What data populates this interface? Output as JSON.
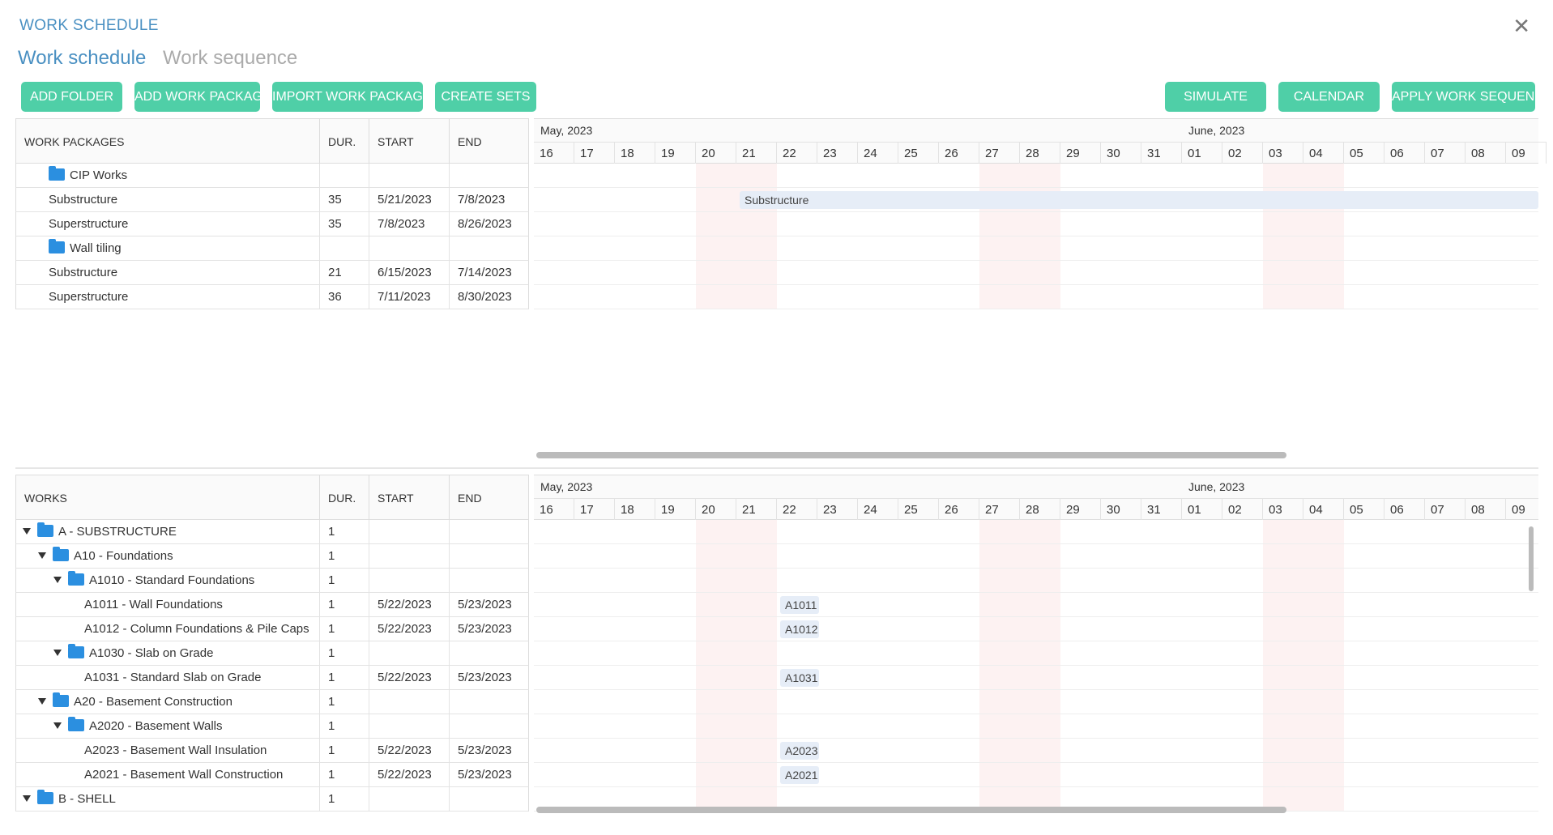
{
  "window": {
    "title": "WORK SCHEDULE",
    "close_glyph": "✕"
  },
  "tabs": [
    {
      "label": "Work schedule",
      "active": true
    },
    {
      "label": "Work sequence",
      "active": false
    }
  ],
  "toolbar": {
    "add_folder": "ADD FOLDER",
    "add_work_package": "ADD WORK PACKAGE",
    "import_work_packages": "IMPORT WORK PACKAGES",
    "create_sets": "CREATE SETS",
    "simulate": "SIMULATE",
    "calendar": "CALENDAR",
    "apply_work_sequence": "APPLY WORK SEQUENCE"
  },
  "timeline": {
    "month1": "May, 2023",
    "month2": "June, 2023",
    "days": [
      "16",
      "17",
      "18",
      "19",
      "20",
      "21",
      "22",
      "23",
      "24",
      "25",
      "26",
      "27",
      "28",
      "29",
      "30",
      "31",
      "01",
      "02",
      "03",
      "04",
      "05",
      "06",
      "07",
      "08",
      "09"
    ]
  },
  "packages": {
    "headers": {
      "name": "WORK PACKAGES",
      "dur": "DUR.",
      "start": "START",
      "end": "END"
    },
    "rows": [
      {
        "name": "CIP Works",
        "folder": true,
        "dur": "",
        "start": "",
        "end": ""
      },
      {
        "name": "Substructure",
        "folder": false,
        "dur": "35",
        "start": "5/21/2023",
        "end": "7/8/2023",
        "bar": "Substructure"
      },
      {
        "name": "Superstructure",
        "folder": false,
        "dur": "35",
        "start": "7/8/2023",
        "end": "8/26/2023"
      },
      {
        "name": "Wall tiling",
        "folder": true,
        "dur": "",
        "start": "",
        "end": ""
      },
      {
        "name": "Substructure",
        "folder": false,
        "dur": "21",
        "start": "6/15/2023",
        "end": "7/14/2023"
      },
      {
        "name": "Superstructure",
        "folder": false,
        "dur": "36",
        "start": "7/11/2023",
        "end": "8/30/2023"
      }
    ]
  },
  "works": {
    "headers": {
      "name": "WORKS",
      "dur": "DUR.",
      "start": "START",
      "end": "END"
    },
    "rows": [
      {
        "name": "A - SUBSTRUCTURE",
        "level": 0,
        "folder": true,
        "dur": "1",
        "start": "",
        "end": ""
      },
      {
        "name": "A10 - Foundations",
        "level": 1,
        "folder": true,
        "dur": "1",
        "start": "",
        "end": ""
      },
      {
        "name": "A1010 - Standard Foundations",
        "level": 2,
        "folder": true,
        "dur": "1",
        "start": "",
        "end": ""
      },
      {
        "name": "A1011 - Wall Foundations",
        "level": 3,
        "folder": false,
        "dur": "1",
        "start": "5/22/2023",
        "end": "5/23/2023",
        "bar": "A1011"
      },
      {
        "name": "A1012 - Column Foundations & Pile Caps",
        "level": 3,
        "folder": false,
        "dur": "1",
        "start": "5/22/2023",
        "end": "5/23/2023",
        "bar": "A1012"
      },
      {
        "name": "A1030 - Slab on Grade",
        "level": 2,
        "folder": true,
        "dur": "1",
        "start": "",
        "end": ""
      },
      {
        "name": "A1031 - Standard Slab on Grade",
        "level": 3,
        "folder": false,
        "dur": "1",
        "start": "5/22/2023",
        "end": "5/23/2023",
        "bar": "A1031"
      },
      {
        "name": "A20 - Basement Construction",
        "level": 1,
        "folder": true,
        "dur": "1",
        "start": "",
        "end": ""
      },
      {
        "name": "A2020 - Basement Walls",
        "level": 2,
        "folder": true,
        "dur": "1",
        "start": "",
        "end": ""
      },
      {
        "name": "A2023 - Basement Wall Insulation",
        "level": 3,
        "folder": false,
        "dur": "1",
        "start": "5/22/2023",
        "end": "5/23/2023",
        "bar": "A2023"
      },
      {
        "name": "A2021 - Basement Wall Construction",
        "level": 3,
        "folder": false,
        "dur": "1",
        "start": "5/22/2023",
        "end": "5/23/2023",
        "bar": "A2021"
      },
      {
        "name": "B - SHELL",
        "level": 0,
        "folder": true,
        "dur": "1",
        "start": "",
        "end": ""
      }
    ]
  },
  "colors": {
    "accent": "#4fcfa7",
    "title": "#4a90c2",
    "folder": "#2b8fe0",
    "weekend": "#fdf2f2",
    "bar": "#e6edf7"
  }
}
